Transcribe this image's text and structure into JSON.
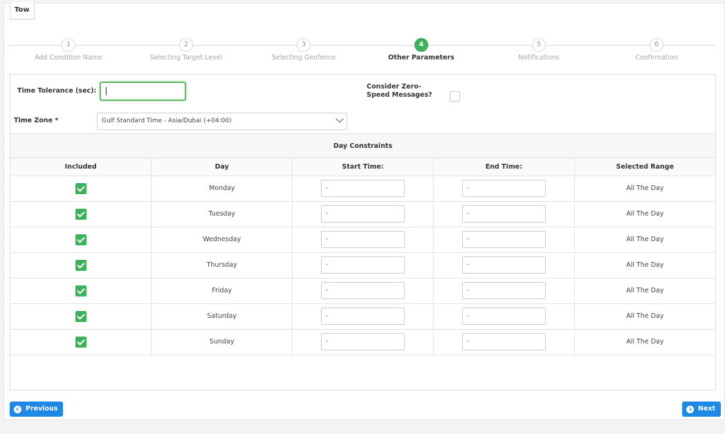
{
  "tab_title": "Tow",
  "steps": [
    {
      "number": "1",
      "label": "Add Condition Name"
    },
    {
      "number": "2",
      "label": "Selecting Target Level"
    },
    {
      "number": "3",
      "label": "Selecting Geofence"
    },
    {
      "number": "4",
      "label": "Other Parameters"
    },
    {
      "number": "5",
      "label": "Notifications"
    },
    {
      "number": "6",
      "label": "Confirmation"
    }
  ],
  "active_step": 4,
  "form": {
    "time_tolerance_label": "Time Tolerance (sec):",
    "time_tolerance_value": "",
    "zero_speed_label": "Consider Zero-Speed Messages?",
    "zero_speed_checked": false,
    "time_zone_label": "Time Zone *",
    "time_zone_value": "Gulf Standard Time - Asia/Dubai (+04:00)"
  },
  "day_constraints": {
    "title": "Day Constraints",
    "columns": [
      "Included",
      "Day",
      "Start Time:",
      "End Time:",
      "Selected Range"
    ],
    "rows": [
      {
        "included": true,
        "day": "Monday",
        "start": "-",
        "end": "-",
        "range": "All The Day"
      },
      {
        "included": true,
        "day": "Tuesday",
        "start": "-",
        "end": "-",
        "range": "All The Day"
      },
      {
        "included": true,
        "day": "Wednesday",
        "start": "-",
        "end": "-",
        "range": "All The Day"
      },
      {
        "included": true,
        "day": "Thursday",
        "start": "-",
        "end": "-",
        "range": "All The Day"
      },
      {
        "included": true,
        "day": "Friday",
        "start": "-",
        "end": "-",
        "range": "All The Day"
      },
      {
        "included": true,
        "day": "Saturday",
        "start": "-",
        "end": "-",
        "range": "All The Day"
      },
      {
        "included": true,
        "day": "Sunday",
        "start": "-",
        "end": "-",
        "range": "All The Day"
      }
    ]
  },
  "buttons": {
    "previous": "Previous",
    "next": "Next"
  },
  "colors": {
    "accent_green": "#3cb35a",
    "button_blue": "#1e88e5"
  }
}
